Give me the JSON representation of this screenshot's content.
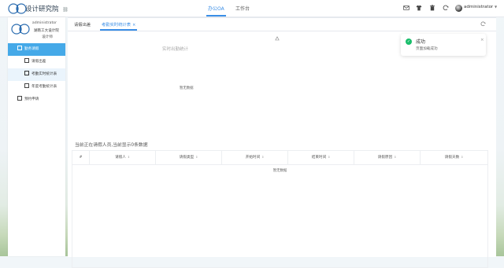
{
  "app": {
    "title": "设计研究院",
    "title_link_icon": "link-icon"
  },
  "header": {
    "nav_tabs": [
      {
        "label": "办公OA",
        "active": true
      },
      {
        "label": "工作台",
        "active": false
      }
    ],
    "icons": [
      "mail-icon",
      "shirt-icon",
      "trash-icon",
      "refresh-icon"
    ],
    "user": {
      "name": "administrator",
      "dropdown_icon": "caret-down-icon"
    }
  },
  "sidebar": {
    "username": "administrator",
    "department": "湖南工大设计院",
    "role": "设计师",
    "menu": [
      {
        "label": "勤务请假",
        "level": 1,
        "state": "active-group",
        "icon": "grid-icon"
      },
      {
        "label": "请假出差",
        "level": 2,
        "state": "",
        "icon": "grid-icon"
      },
      {
        "label": "考勤实时统计表",
        "level": 2,
        "state": "active-sub",
        "icon": "grid-icon"
      },
      {
        "label": "年度考勤统计表",
        "level": 2,
        "state": "",
        "icon": "grid-icon"
      },
      {
        "label": "预约申请",
        "level": 1,
        "state": "",
        "icon": "grid-icon"
      }
    ]
  },
  "tabs": [
    {
      "label": "请假出差",
      "active": false,
      "closable": false
    },
    {
      "label": "考勤实时统计表",
      "active": true,
      "closable": true,
      "close_glyph": "×"
    }
  ],
  "chart": {
    "title": "实时出勤统计",
    "empty_text": "暂无数据",
    "legend_icon": "legend-icon"
  },
  "table": {
    "title": "当前正在请假人员,当前显示0条数据",
    "index_label": "#",
    "sort_glyph": "⇕",
    "columns": [
      "请假人",
      "请假类型",
      "开始时间",
      "结束时间",
      "请假原因",
      "请假天数"
    ],
    "rows": [],
    "empty_text": "暂无数据"
  },
  "toast": {
    "type": "success",
    "title": "成功",
    "message": "页面加载成功",
    "check_glyph": "✓",
    "close_glyph": "×"
  },
  "colors": {
    "accent": "#3a8ee6",
    "sidebar_active": "#45a9e8",
    "success": "#19be6b"
  }
}
